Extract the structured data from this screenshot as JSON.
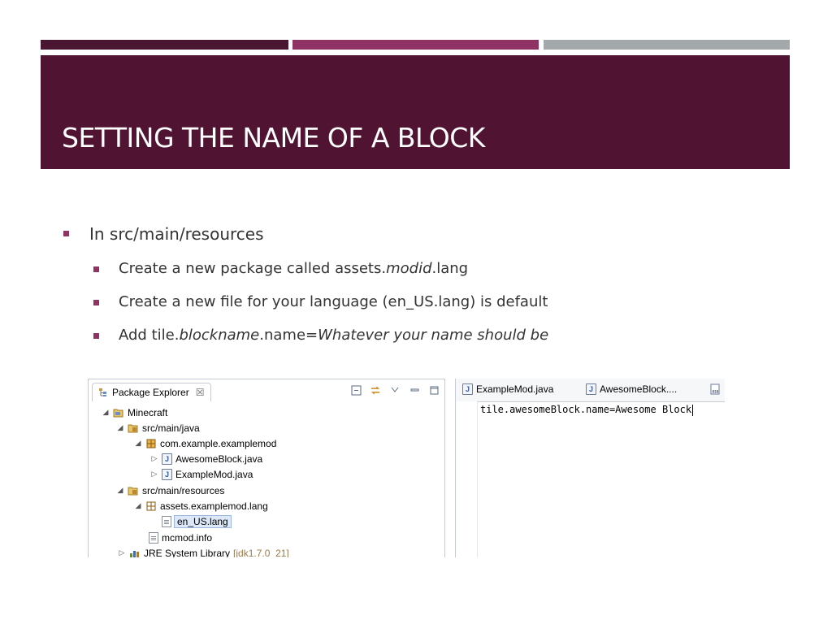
{
  "slide": {
    "title": "SETTING THE NAME OF A BLOCK",
    "accent_colors": {
      "dark": "#501432",
      "magenta": "#8e3363",
      "gray": "#a3a8ab"
    }
  },
  "bullets": {
    "b1": "In src/main/resources",
    "b2_pre": "Create a new package called assets.",
    "b2_it": "modid",
    "b2_post": ".lang",
    "b3": "Create a new file for your language (en_US.lang) is default",
    "b4_pre": "Add tile.",
    "b4_it1": "blockname",
    "b4_mid": ".name=",
    "b4_it2": "Whatever your name should be"
  },
  "explorer": {
    "tab_label": "Package Explorer",
    "close_glyph": "☒",
    "tree": {
      "project": "Minecraft",
      "src_java": "src/main/java",
      "pkg": "com.example.examplemod",
      "file1": "AwesomeBlock.java",
      "file2": "ExampleMod.java",
      "src_res": "src/main/resources",
      "assets_pkg": "assets.examplemod.lang",
      "lang_file": "en_US.lang",
      "mcmod": "mcmod.info",
      "jre": "JRE System Library",
      "jre_version": "[jdk1.7.0_21]"
    },
    "icons": [
      "project-folder-icon",
      "source-folder-icon",
      "package-icon",
      "java-file-icon",
      "text-file-icon",
      "library-icon"
    ]
  },
  "editor": {
    "tab1": "ExampleMod.java",
    "tab2": "AwesomeBlock....",
    "code_line": "tile.awesomeBlock.name=Awesome Block"
  }
}
